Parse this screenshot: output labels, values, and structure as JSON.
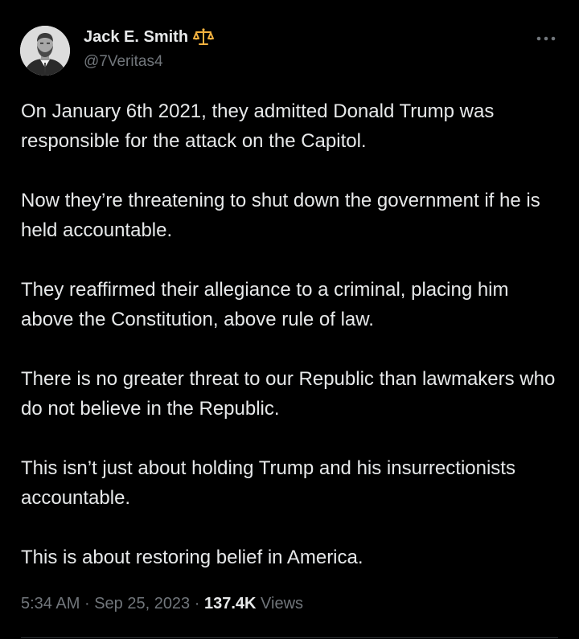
{
  "author": {
    "display_name": "Jack E. Smith",
    "badge_icon": "scales-icon",
    "handle": "@7Veritas4"
  },
  "menu_icon": "more-horizontal-icon",
  "tweet": {
    "paragraphs": [
      "On January 6th 2021, they admitted Donald Trump was responsible for the attack on the Capitol.",
      "Now they’re threatening to shut down the government if he is held accountable.",
      "They reaffirmed their allegiance to a criminal, placing him above the Constitution, above rule of law.",
      "There is no greater threat to our Republic than lawmakers who do not believe in the Republic.",
      "This isn’t just about holding Trump and his insurrectionists accountable.",
      "This is about restoring belief in America."
    ]
  },
  "meta": {
    "time": "5:34 AM",
    "separator": "·",
    "date": "Sep 25, 2023",
    "views_count": "137.4K",
    "views_label": "Views"
  },
  "colors": {
    "background": "#000000",
    "text_primary": "#e7e9ea",
    "text_secondary": "#71767b",
    "divider": "#2f3336",
    "badge": "#f4b23f"
  }
}
